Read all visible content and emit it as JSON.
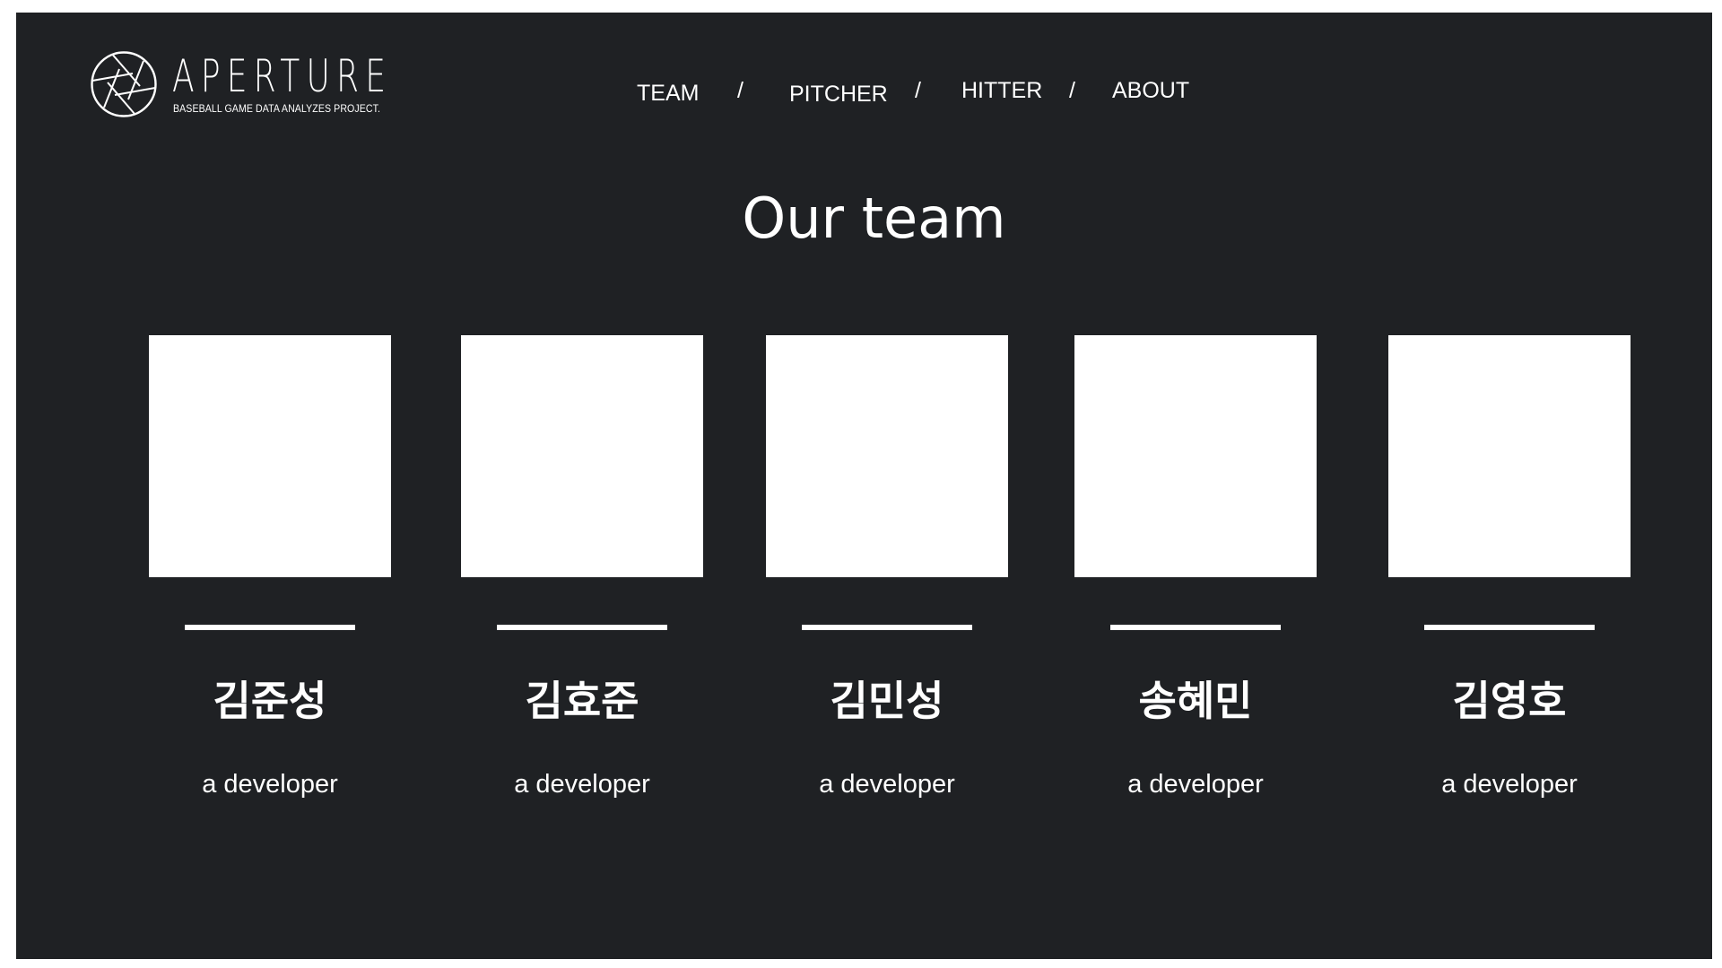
{
  "brand": {
    "name": "APERTURE",
    "tagline": "BASEBALL GAME DATA ANALYZES PROJECT.",
    "logo_icon": "aperture-icon"
  },
  "nav": {
    "items": [
      {
        "label": "TEAM"
      },
      {
        "label": "PITCHER"
      },
      {
        "label": "HITTER"
      },
      {
        "label": "ABOUT"
      }
    ],
    "separator": "/"
  },
  "page": {
    "title": "Our team"
  },
  "team": {
    "members": [
      {
        "name": "김준성",
        "role": "a developer"
      },
      {
        "name": "김효준",
        "role": "a developer"
      },
      {
        "name": "김민성",
        "role": "a developer"
      },
      {
        "name": "송혜민",
        "role": "a developer"
      },
      {
        "name": "김영호",
        "role": "a developer"
      }
    ]
  },
  "colors": {
    "background": "#1f2124",
    "foreground": "#ffffff",
    "page_border": "#ffffff"
  }
}
